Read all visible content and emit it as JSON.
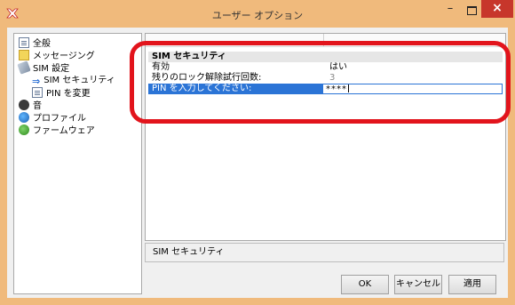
{
  "window": {
    "title": "ユーザー オプション"
  },
  "tree": {
    "items": [
      {
        "label": "全般",
        "icon": "document-icon"
      },
      {
        "label": "メッセージング",
        "icon": "message-icon"
      },
      {
        "label": "SIM 設定",
        "icon": "sim-card-icon"
      },
      {
        "label": "SIM セキュリティ",
        "icon": "arrow-right-icon",
        "selected": true
      },
      {
        "label": "PIN を変更",
        "icon": "document-icon"
      },
      {
        "label": "音",
        "icon": "sound-icon"
      },
      {
        "label": "プロファイル",
        "icon": "profile-icon"
      },
      {
        "label": "ファームウェア",
        "icon": "firmware-icon"
      }
    ]
  },
  "panel": {
    "section_title": "SIM セキュリティ",
    "rows": [
      {
        "key": "有効",
        "value": "はい"
      },
      {
        "key": "残りのロック解除試行回数:",
        "value": "3"
      },
      {
        "key": "PIN を入力してください:",
        "value": "****"
      }
    ]
  },
  "description": "SIM セキュリティ",
  "buttons": {
    "ok": "OK",
    "cancel": "キャンセル",
    "apply": "適用"
  },
  "colors": {
    "title_bar": "#f0ba7c",
    "close": "#c7362b",
    "selection": "#2b74d6",
    "highlight_ring": "#e2141c"
  }
}
